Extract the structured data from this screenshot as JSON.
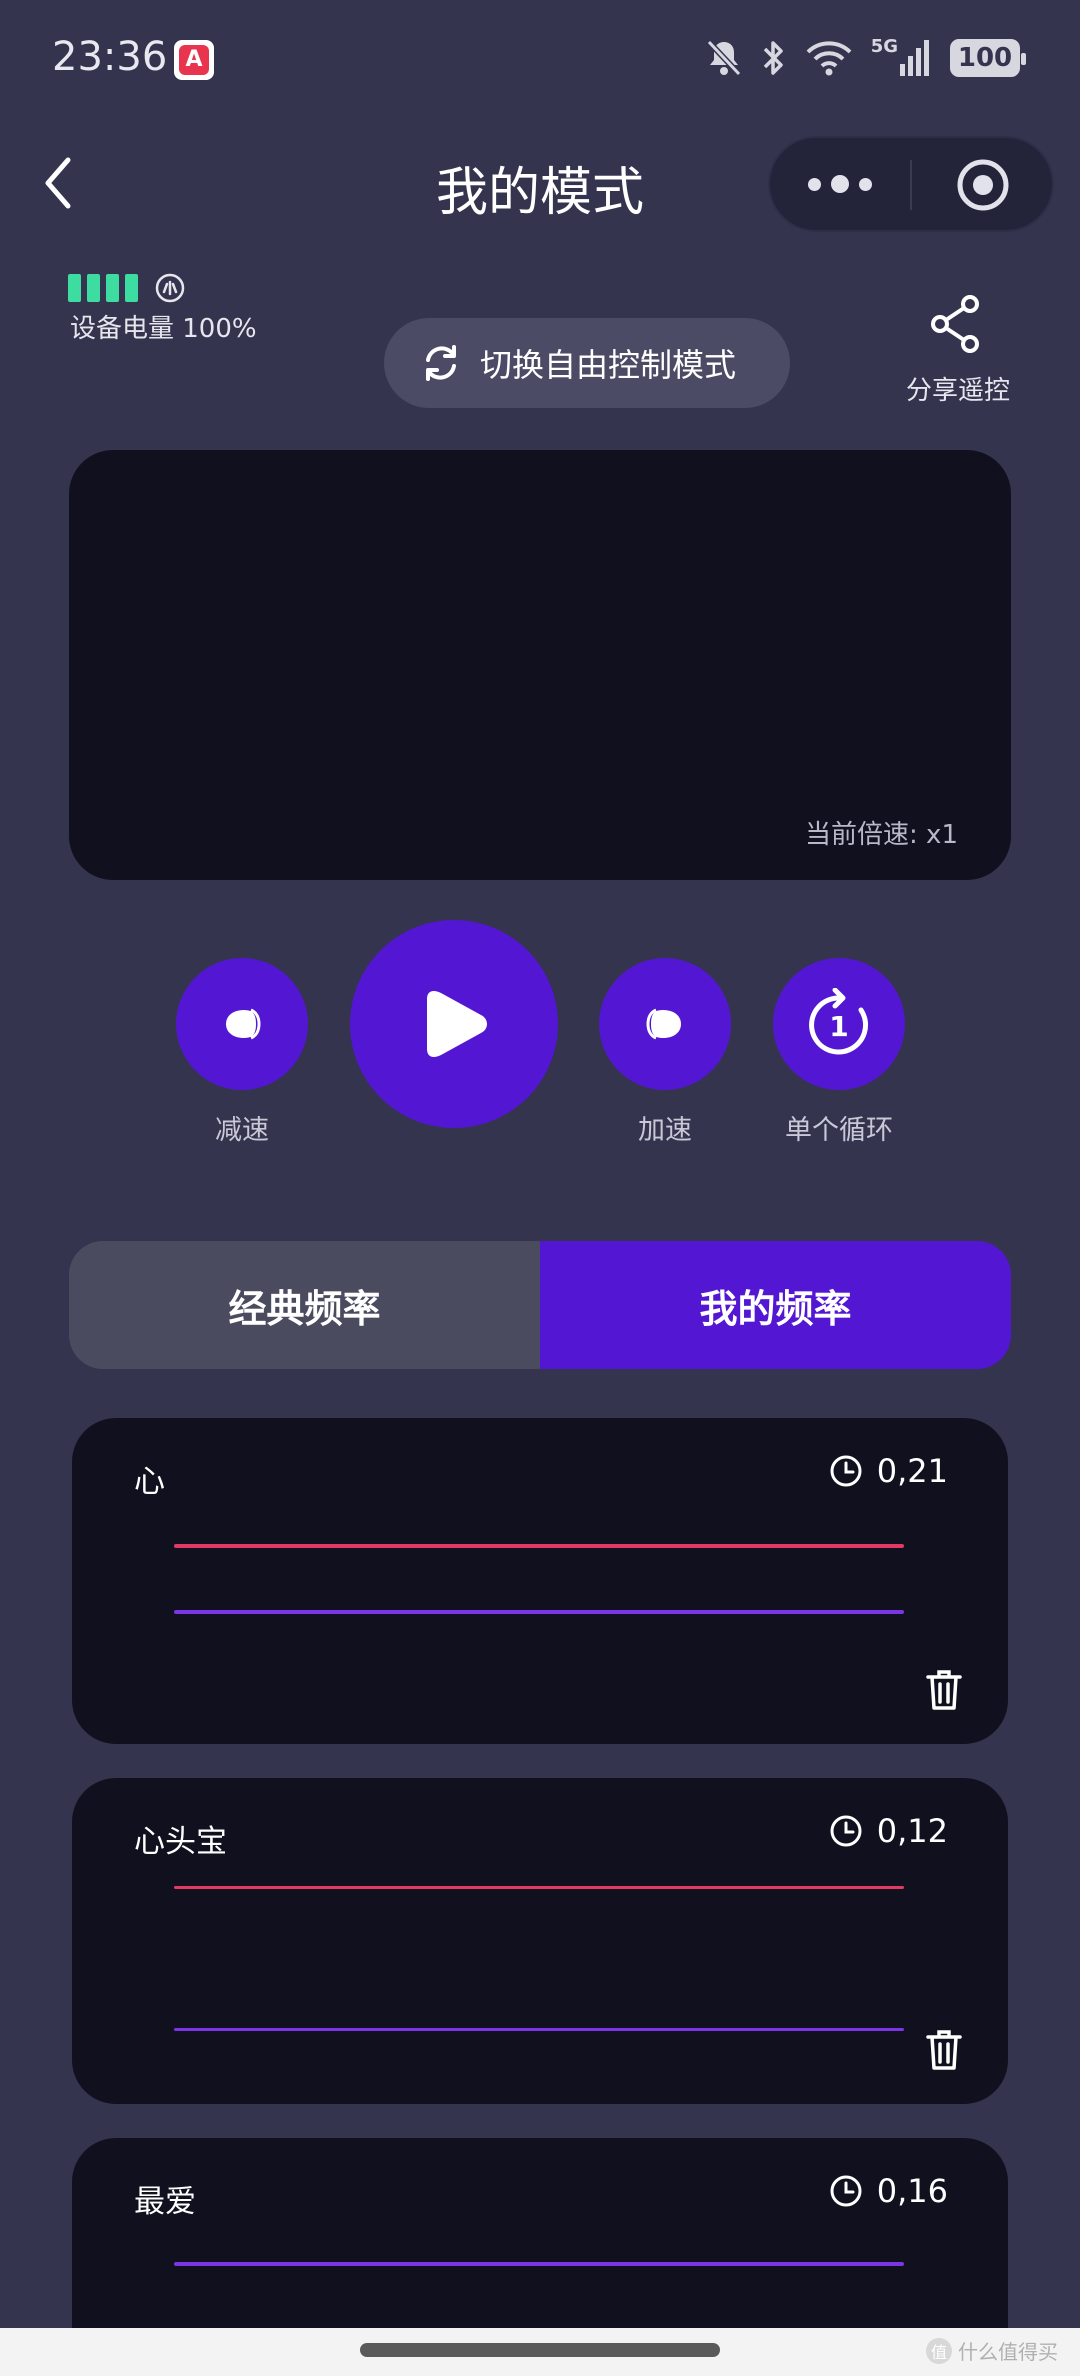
{
  "status_bar": {
    "time": "23:36",
    "network": "5G",
    "battery": "100"
  },
  "nav": {
    "title": "我的模式"
  },
  "device": {
    "battery_label": "设备电量 100%",
    "battery_level": 1.0
  },
  "actions": {
    "switch_mode": "切换自由控制模式",
    "share": "分享遥控"
  },
  "display": {
    "speed_text": "当前倍速: x1"
  },
  "controls": {
    "slow": "减速",
    "fast": "加速",
    "loop": "单个循环",
    "loop_count": "1"
  },
  "tabs": {
    "classic": "经典频率",
    "mine": "我的频率",
    "active": "mine"
  },
  "patterns": [
    {
      "name": "心",
      "duration": "0,21"
    },
    {
      "name": "心头宝",
      "duration": "0,12"
    },
    {
      "name": "最爱",
      "duration": "0,16"
    }
  ],
  "colors": {
    "background": "#34344f",
    "accent": "#5317d3",
    "panel": "#10101e",
    "battery_green": "#3ddca0",
    "line_red": "#e23a64",
    "line_purple": "#7b34e6"
  },
  "watermark": "什么值得买"
}
